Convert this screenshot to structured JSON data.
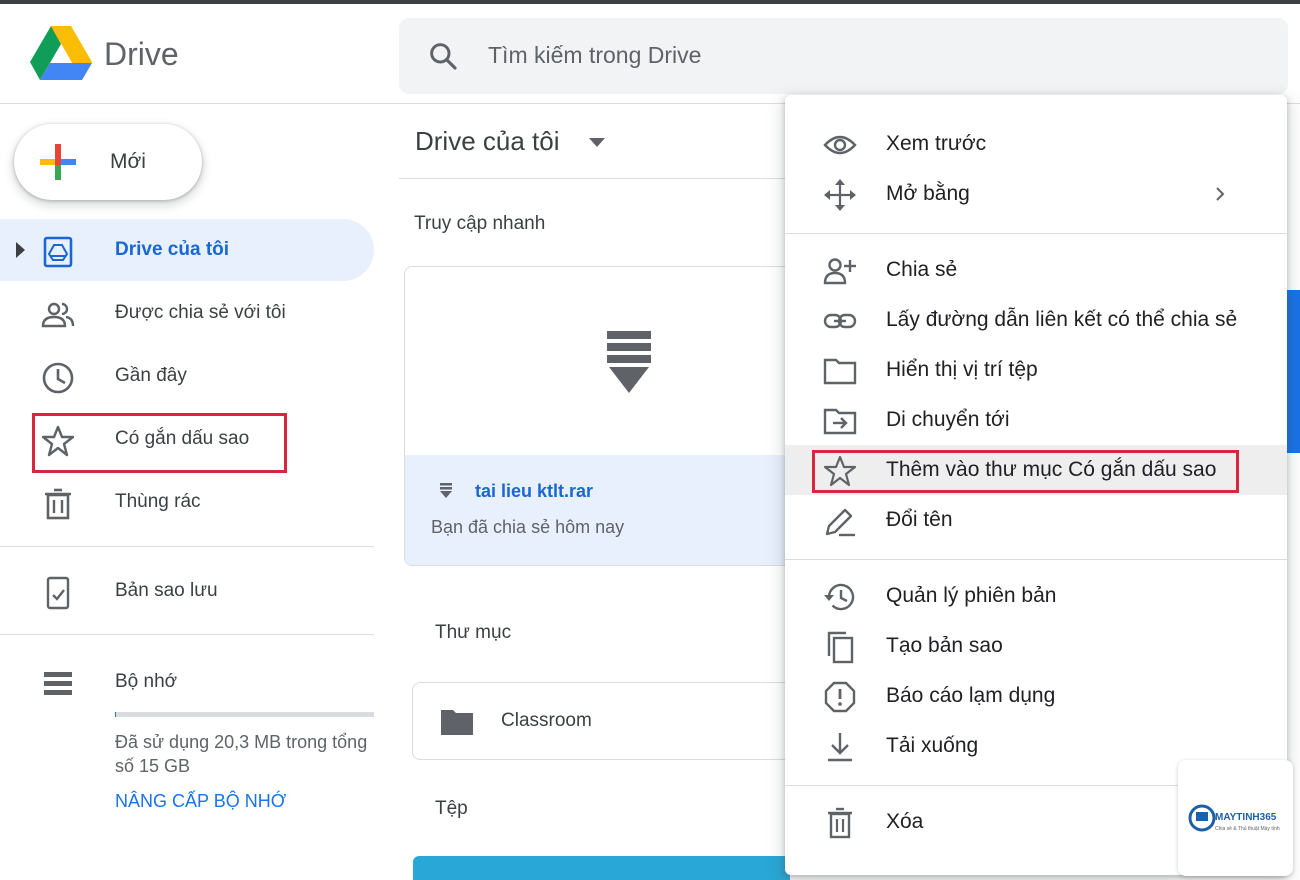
{
  "header": {
    "app_name": "Drive",
    "search_placeholder": "Tìm kiếm trong Drive"
  },
  "sidebar": {
    "new_button": "Mới",
    "items": [
      {
        "label": "Drive của tôi",
        "icon": "my-drive-icon",
        "active": true
      },
      {
        "label": "Được chia sẻ với tôi",
        "icon": "shared-people-icon"
      },
      {
        "label": "Gần đây",
        "icon": "clock-icon"
      },
      {
        "label": "Có gắn dấu sao",
        "icon": "star-icon",
        "highlighted": true
      },
      {
        "label": "Thùng rác",
        "icon": "trash-icon"
      },
      {
        "label": "Bản sao lưu",
        "icon": "backup-icon"
      },
      {
        "label": "Bộ nhớ",
        "icon": "storage-icon"
      }
    ],
    "storage": {
      "used_text": "Đã sử dụng 20,3 MB trong tổng số 15 GB",
      "used_fraction": 0.0013,
      "upgrade_label": "NÂNG CẤP BỘ NHỚ"
    }
  },
  "main": {
    "title": "Drive của tôi",
    "quick_access_label": "Truy cập nhanh",
    "quick_file": {
      "name": "tai lieu ktlt.rar",
      "subtitle": "Bạn đã chia sẻ hôm nay"
    },
    "folders_label": "Thư mục",
    "folder": {
      "name": "Classroom"
    },
    "files_label": "Tệp"
  },
  "context_menu": {
    "items": [
      {
        "label": "Xem trước",
        "icon": "eye-icon"
      },
      {
        "label": "Mở bằng",
        "icon": "move-arrows-icon",
        "submenu": true
      },
      {
        "label": "Chia sẻ",
        "icon": "add-person-icon"
      },
      {
        "label": "Lấy đường dẫn liên kết có thể chia sẻ",
        "icon": "link-icon"
      },
      {
        "label": "Hiển thị vị trí tệp",
        "icon": "folder-icon"
      },
      {
        "label": "Di chuyển tới",
        "icon": "move-to-folder-icon"
      },
      {
        "label": "Thêm vào thư mục Có gắn dấu sao",
        "icon": "star-icon",
        "highlighted": true
      },
      {
        "label": "Đổi tên",
        "icon": "pencil-icon"
      },
      {
        "label": "Quản lý phiên bản",
        "icon": "history-icon"
      },
      {
        "label": "Tạo bản sao",
        "icon": "copy-icon"
      },
      {
        "label": "Báo cáo lạm dụng",
        "icon": "alert-icon"
      },
      {
        "label": "Tải xuống",
        "icon": "download-icon"
      },
      {
        "label": "Xóa",
        "icon": "trash-icon"
      }
    ]
  },
  "watermark": {
    "name": "MAYTINH365",
    "tagline": "Chia sẻ & Thủ thuật Máy tính"
  },
  "colors": {
    "accent_blue": "#1a73e8",
    "active_bg": "#e8f0fe",
    "highlight_red": "#d7263d"
  }
}
